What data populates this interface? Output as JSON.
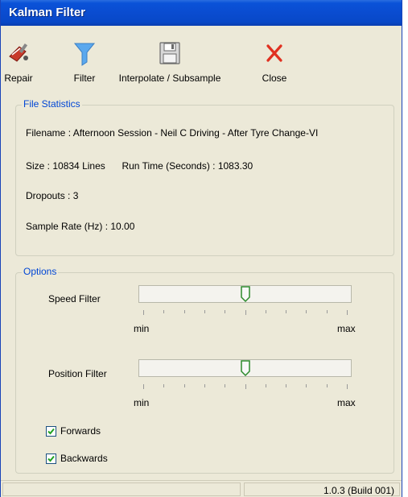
{
  "window": {
    "title": "Kalman Filter"
  },
  "toolbar": {
    "buttons": [
      {
        "label": "Repair",
        "icon": "repair-icon"
      },
      {
        "label": "Filter",
        "icon": "filter-icon"
      },
      {
        "label": "Interpolate / Subsample",
        "icon": "floppy-disk-icon"
      },
      {
        "label": "Close",
        "icon": "close-icon"
      }
    ]
  },
  "file_statistics": {
    "legend": "File Statistics",
    "filename_label": "Filename :",
    "filename_value": "Afternoon Session - Neil C Driving - After Tyre Change-VI",
    "size_label": "Size :",
    "size_value": "10834 Lines",
    "runtime_label": "Run Time (Seconds) :",
    "runtime_value": "1083.30",
    "dropouts_label": "Dropouts :",
    "dropouts_value": "3",
    "samplerate_label": "Sample Rate (Hz) :",
    "samplerate_value": "10.00"
  },
  "options": {
    "legend": "Options",
    "speed_filter": {
      "label": "Speed Filter",
      "min_label": "min",
      "max_label": "max",
      "position_fraction": 0.5
    },
    "position_filter": {
      "label": "Position Filter",
      "min_label": "min",
      "max_label": "max",
      "position_fraction": 0.5
    },
    "forwards": {
      "label": "Forwards",
      "checked": true
    },
    "backwards": {
      "label": "Backwards",
      "checked": true
    }
  },
  "statusbar": {
    "version": "1.0.3 (Build 001)"
  },
  "colors": {
    "titlebar": "#0A4CD0",
    "legend_text": "#0046D5",
    "background": "#ECE9D8",
    "close_x": "#E03020",
    "filter_funnel": "#5AA8EE"
  }
}
